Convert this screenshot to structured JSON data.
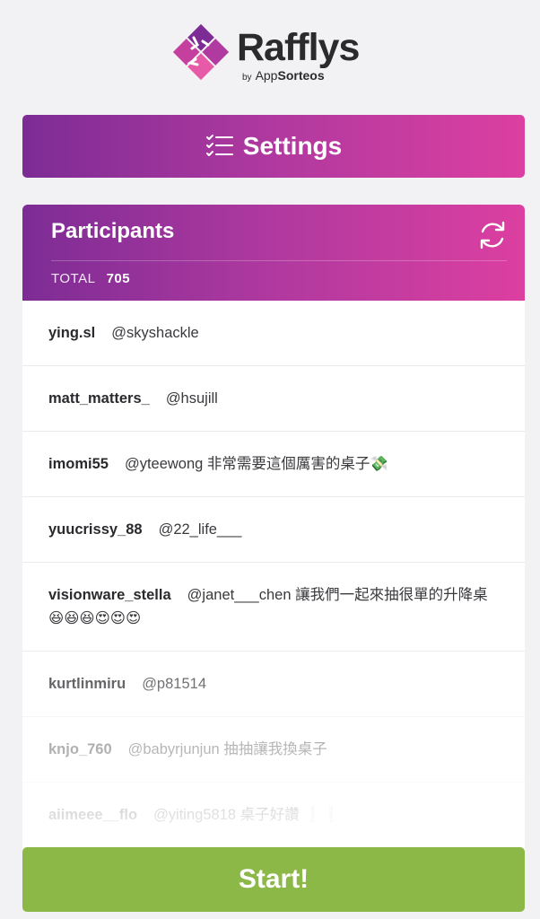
{
  "brand": {
    "name": "Rafflys",
    "by_prefix": "by",
    "by_name_a": "App",
    "by_name_b": "Sorteos",
    "colors": {
      "purple": "#7d2c95",
      "magenta": "#dc3fa0",
      "pink": "#e85aa8"
    }
  },
  "settings": {
    "label": "Settings",
    "icon": "checklist-icon"
  },
  "participants": {
    "title": "Participants",
    "total_label": "TOTAL",
    "total_value": "705",
    "refresh_icon": "refresh-icon",
    "entries": [
      {
        "user": "ying.sl",
        "comment": "@skyshackle"
      },
      {
        "user": "matt_matters_",
        "comment": "@hsujill"
      },
      {
        "user": "imomi55",
        "comment": "@yteewong 非常需要這個厲害的桌子💸"
      },
      {
        "user": "yuucrissy_88",
        "comment": "@22_life___"
      },
      {
        "user": "visionware_stella",
        "comment": "@janet___chen 讓我們一起來抽很單的升降桌😆😆😆😍😍😍"
      },
      {
        "user": "kurtlinmiru",
        "comment": "@p81514"
      },
      {
        "user": "knjo_760",
        "comment": "@babyrjunjun 抽抽讓我換桌子"
      },
      {
        "user": "aiimeee__flo",
        "comment": "@yiting5818 桌子好讚 ❕❕"
      }
    ]
  },
  "start": {
    "label": "Start!",
    "color": "#8cb848"
  }
}
